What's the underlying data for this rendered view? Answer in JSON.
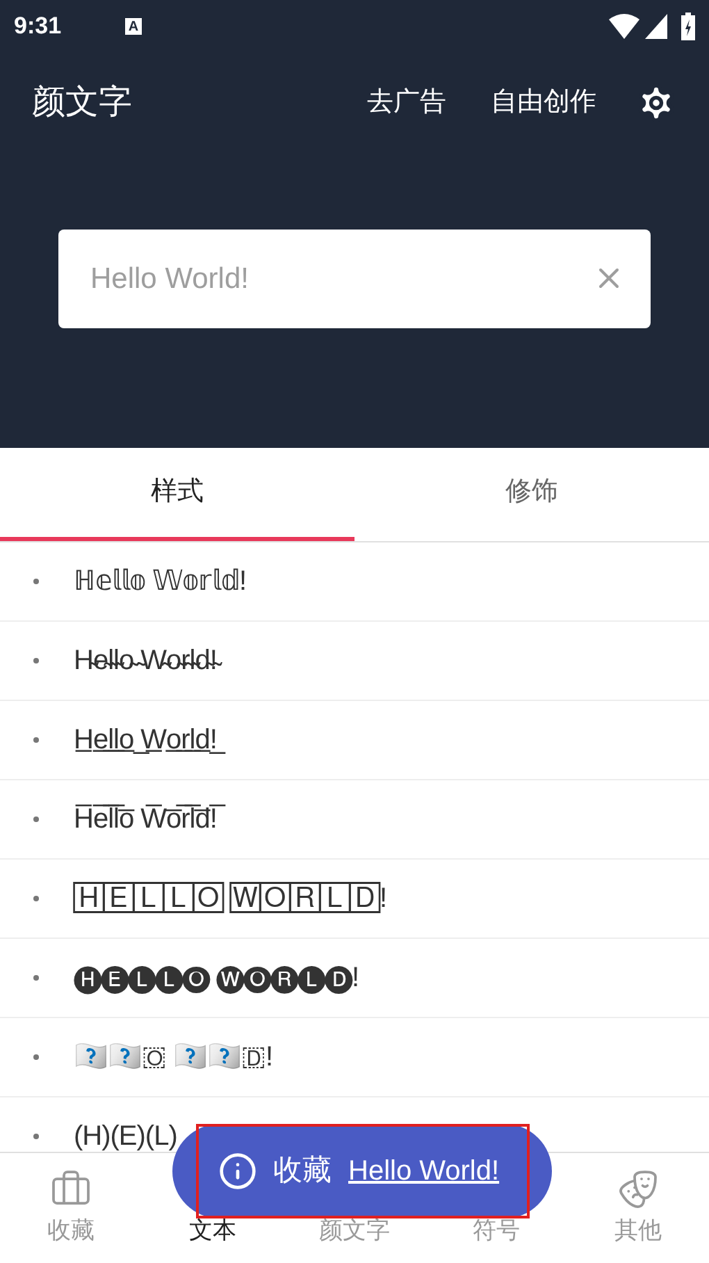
{
  "status_bar": {
    "time": "9:31",
    "notification": "A"
  },
  "app_bar": {
    "title": "颜文字",
    "actions": [
      "去广告",
      "自由创作"
    ]
  },
  "search": {
    "value": "Hello World!"
  },
  "tabs": [
    {
      "label": "样式",
      "selected": true
    },
    {
      "label": "修饰",
      "selected": false
    }
  ],
  "styles": [
    {
      "text": "ℍ𝕖𝕝𝕝𝕠 𝕎𝕠𝕣𝕝𝕕!"
    },
    {
      "text": "H̴e̴l̴l̴o̴ ̴W̴o̴r̴l̴d̴!̴"
    },
    {
      "text": "H̲e̲l̲l̲o̲ ̲W̲o̲r̲l̲d̲!̲"
    },
    {
      "text": "H̅e̅l̅l̅o̅ W̅o̅r̅l̅d̅!̅"
    },
    {
      "text": "🄷🄴🄻🄻🄾 🅆🄾🅁🄻🄳!"
    },
    {
      "text": "🅗🅔🅛🅛🅞 🅦🅞🅡🅛🅓!"
    },
    {
      "text": "🇭🇪🇱🇱🇴 🇼🇴🇷🇱🇩!"
    },
    {
      "text": "(H)(E)(L)"
    }
  ],
  "toast": {
    "message": "收藏",
    "link": "Hello World!"
  },
  "bottom_nav": [
    {
      "label": "收藏",
      "selected": false
    },
    {
      "label": "文本",
      "selected": true
    },
    {
      "label": "颜文字",
      "selected": false
    },
    {
      "label": "符号",
      "selected": false
    },
    {
      "label": "其他",
      "selected": false
    }
  ]
}
